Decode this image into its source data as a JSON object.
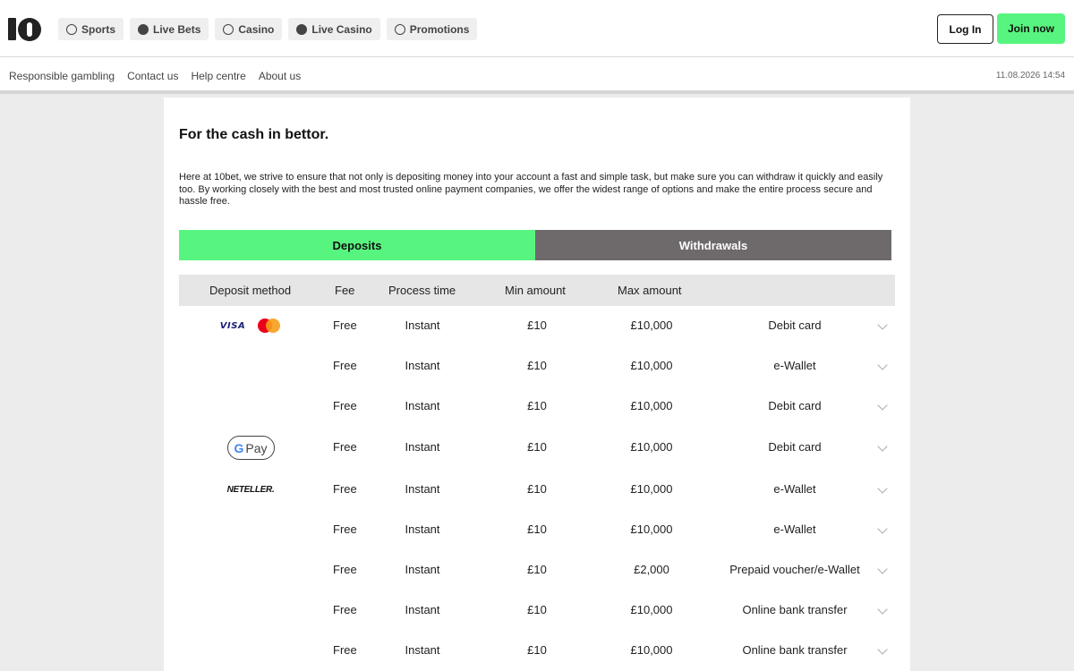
{
  "header": {
    "nav": [
      {
        "label": "Sports",
        "icon": "soccer-ball-icon"
      },
      {
        "label": "Live Bets",
        "icon": "live-icon"
      },
      {
        "label": "Casino",
        "icon": "casino-chip-icon"
      },
      {
        "label": "Live Casino",
        "icon": "roulette-icon"
      },
      {
        "label": "Promotions",
        "icon": "promotions-icon"
      }
    ],
    "login_label": "Log In",
    "join_label": "Join now",
    "subnav": [
      "Responsible gambling",
      "Contact us",
      "Help centre",
      "About us"
    ],
    "datetime": "11.08.2026 14:54",
    "accent_color": "#57f57f"
  },
  "main": {
    "title": "For the cash in bettor.",
    "intro": "Here at 10bet, we strive to ensure that not only is depositing money into your account a fast and simple task, but make sure you can withdraw it quickly and easily too. By working closely with the best and most trusted online payment companies, we offer the widest range of options and make the entire process secure and hassle free.",
    "tabs": [
      {
        "label": "Deposits",
        "active": true
      },
      {
        "label": "Withdrawals",
        "active": false
      }
    ],
    "table": {
      "headers": [
        "Deposit method",
        "Fee",
        "Process time",
        "Min amount",
        "Max amount"
      ],
      "rows": [
        {
          "logo": "visa-mastercard",
          "visa_text": "VISA",
          "fee": "Free",
          "time": "Instant",
          "min": "£10",
          "max": "£10,000",
          "type": "Debit card"
        },
        {
          "logo": "",
          "fee": "Free",
          "time": "Instant",
          "min": "£10",
          "max": "£10,000",
          "type": "e-Wallet"
        },
        {
          "logo": "",
          "fee": "Free",
          "time": "Instant",
          "min": "£10",
          "max": "£10,000",
          "type": "Debit card"
        },
        {
          "logo": "google-pay",
          "gpay_g": "G",
          "gpay_text": "Pay",
          "fee": "Free",
          "time": "Instant",
          "min": "£10",
          "max": "£10,000",
          "type": "Debit card"
        },
        {
          "logo": "neteller",
          "neteller_text": "NETELLER.",
          "fee": "Free",
          "time": "Instant",
          "min": "£10",
          "max": "£10,000",
          "type": "e-Wallet"
        },
        {
          "logo": "",
          "fee": "Free",
          "time": "Instant",
          "min": "£10",
          "max": "£10,000",
          "type": "e-Wallet"
        },
        {
          "logo": "",
          "fee": "Free",
          "time": "Instant",
          "min": "£10",
          "max": "£2,000",
          "type": "Prepaid voucher/e-Wallet"
        },
        {
          "logo": "",
          "fee": "Free",
          "time": "Instant",
          "min": "£10",
          "max": "£10,000",
          "type": "Online bank transfer"
        },
        {
          "logo": "",
          "fee": "Free",
          "time": "Instant",
          "min": "£10",
          "max": "£10,000",
          "type": "Online bank transfer"
        }
      ]
    }
  }
}
